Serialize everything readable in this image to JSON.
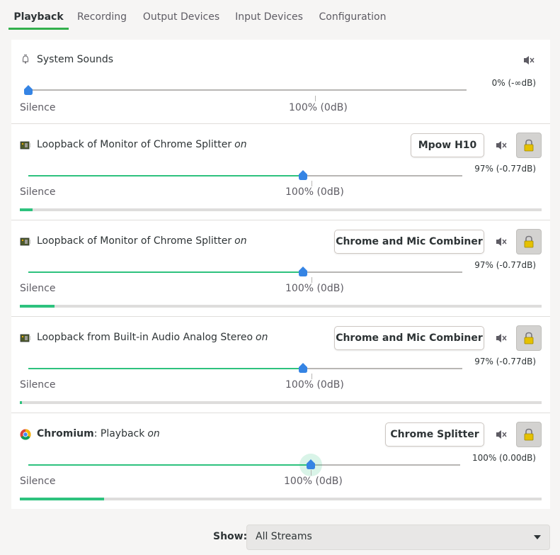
{
  "tabs": [
    {
      "label": "Playback",
      "active": true
    },
    {
      "label": "Recording",
      "active": false
    },
    {
      "label": "Output Devices",
      "active": false
    },
    {
      "label": "Input Devices",
      "active": false
    },
    {
      "label": "Configuration",
      "active": false
    }
  ],
  "scale_labels": {
    "silence": "Silence",
    "hundred": "100% (0dB)"
  },
  "system_sounds": {
    "name": "System Sounds",
    "icon": "bell-icon",
    "volume_text": "0% (-∞dB)",
    "volume_fraction": 0.0
  },
  "streams": [
    {
      "name": "Loopback of Monitor of Chrome Splitter",
      "state": "on",
      "icon": "audio-card-icon",
      "device": "Mpow H10",
      "volume_text": "97% (-0.77dB)",
      "volume_percent": 97,
      "level_fraction": 0.024
    },
    {
      "name": "Loopback of Monitor of Chrome Splitter",
      "state": "on",
      "icon": "audio-card-icon",
      "device": "Chrome and Mic Combiner",
      "volume_text": "97% (-0.77dB)",
      "volume_percent": 97,
      "level_fraction": 0.066
    },
    {
      "name": "Loopback from Built-in Audio Analog Stereo",
      "state": "on",
      "icon": "audio-card-icon",
      "device": "Chrome and Mic Combiner",
      "volume_text": "97% (-0.77dB)",
      "volume_percent": 97,
      "level_fraction": 0.004
    },
    {
      "name_bold": "Chromium",
      "name_rest": ": Playback",
      "state": "on",
      "icon": "chromium-icon",
      "device": "Chrome Splitter",
      "volume_text": "100% (0.00dB)",
      "volume_percent": 100,
      "level_fraction": 0.162
    }
  ],
  "show": {
    "label": "Show:",
    "value": "All Streams"
  },
  "colors": {
    "accent": "#2ec27e",
    "knob": "#3584e4",
    "tab_underline": "#33b04c"
  }
}
